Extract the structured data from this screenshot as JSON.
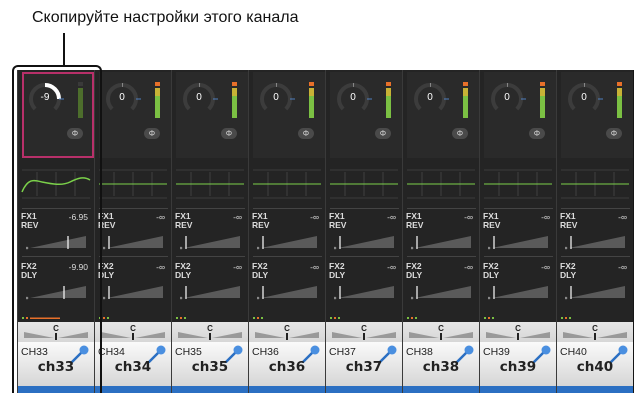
{
  "caption": "Скопируйте настройки этого канала",
  "phase_symbol": "Φ",
  "channels": [
    {
      "gain": "-9",
      "fx1_label": "FX1\nREV",
      "fx1_val": "-6.95",
      "fx2_label": "FX2\nDLY",
      "fx2_val": "-9.90",
      "pan": "C",
      "num": "CH33",
      "name": "ch33",
      "selected": true
    },
    {
      "gain": "0",
      "fx1_label": "FX1\nREV",
      "fx1_val": "-∞",
      "fx2_label": "FX2\nDLY",
      "fx2_val": "-∞",
      "pan": "C",
      "num": "CH34",
      "name": "ch34",
      "selected": false
    },
    {
      "gain": "0",
      "fx1_label": "FX1\nREV",
      "fx1_val": "-∞",
      "fx2_label": "FX2\nDLY",
      "fx2_val": "-∞",
      "pan": "C",
      "num": "CH35",
      "name": "ch35",
      "selected": false
    },
    {
      "gain": "0",
      "fx1_label": "FX1\nREV",
      "fx1_val": "-∞",
      "fx2_label": "FX2\nDLY",
      "fx2_val": "-∞",
      "pan": "C",
      "num": "CH36",
      "name": "ch36",
      "selected": false
    },
    {
      "gain": "0",
      "fx1_label": "FX1\nREV",
      "fx1_val": "-∞",
      "fx2_label": "FX2\nDLY",
      "fx2_val": "-∞",
      "pan": "C",
      "num": "CH37",
      "name": "ch37",
      "selected": false
    },
    {
      "gain": "0",
      "fx1_label": "FX1\nREV",
      "fx1_val": "-∞",
      "fx2_label": "FX2\nDLY",
      "fx2_val": "-∞",
      "pan": "C",
      "num": "CH38",
      "name": "ch38",
      "selected": false
    },
    {
      "gain": "0",
      "fx1_label": "FX1\nREV",
      "fx1_val": "-∞",
      "fx2_label": "FX2\nDLY",
      "fx2_val": "-∞",
      "pan": "C",
      "num": "CH39",
      "name": "ch39",
      "selected": false
    },
    {
      "gain": "0",
      "fx1_label": "FX1\nREV",
      "fx1_val": "-∞",
      "fx2_label": "FX2\nDLY",
      "fx2_val": "-∞",
      "pan": "C",
      "num": "CH40",
      "name": "ch40",
      "selected": false
    }
  ],
  "colors": {
    "selected_outline": "#b8306a",
    "eq_curve": "#7bd14a",
    "meter_green": "#7bc043",
    "meter_orange": "#e8702a",
    "name_bar": "#2b6fc2"
  }
}
